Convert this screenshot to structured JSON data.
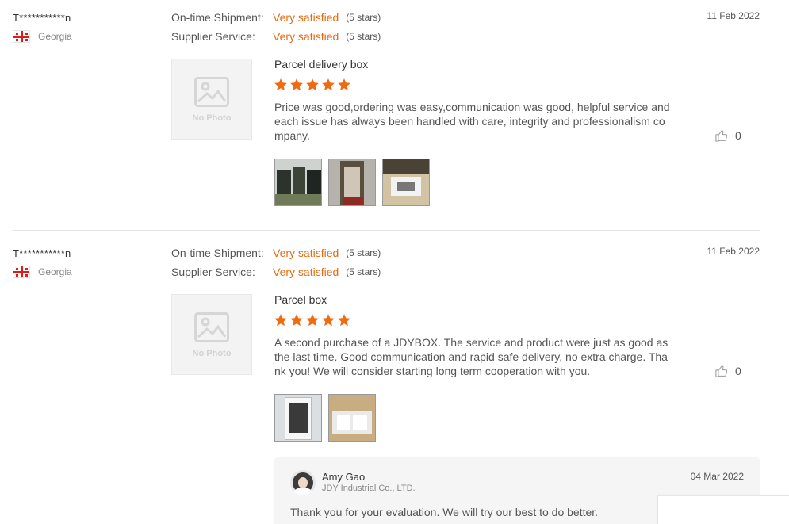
{
  "reviews": [
    {
      "buyer": "T***********n",
      "country": "Georgia",
      "ratings": [
        {
          "label": "On-time Shipment:",
          "value": "Very satisfied",
          "stars": "(5 stars)"
        },
        {
          "label": "Supplier Service:",
          "value": "Very satisfied",
          "stars": "(5 stars)"
        }
      ],
      "date": "11 Feb 2022",
      "no_photo": "No Photo",
      "product": "Parcel delivery box",
      "star_rating": 5,
      "text": "Price was good,ordering was easy,communication was good, helpful service and each issue has always been handled with care, integrity and professionalism company.",
      "likes": "0"
    },
    {
      "buyer": "T***********n",
      "country": "Georgia",
      "ratings": [
        {
          "label": "On-time Shipment:",
          "value": "Very satisfied",
          "stars": "(5 stars)"
        },
        {
          "label": "Supplier Service:",
          "value": "Very satisfied",
          "stars": "(5 stars)"
        }
      ],
      "date": "11 Feb 2022",
      "no_photo": "No Photo",
      "product": "Parcel box",
      "star_rating": 5,
      "text": "A second purchase of a JDYBOX. The service and product were just as good as the last time. Good communication and rapid safe delivery, no extra charge. Thank you! We will consider starting long term cooperation with you.",
      "likes": "0",
      "reply": {
        "name": "Amy Gao",
        "company": "JDY Industrial Co., LTD.",
        "date": "04 Mar 2022",
        "text": "Thank you for your evaluation. We will try our best to do better."
      }
    }
  ],
  "colors": {
    "accent": "#e56b12",
    "star": "#f26a10"
  }
}
